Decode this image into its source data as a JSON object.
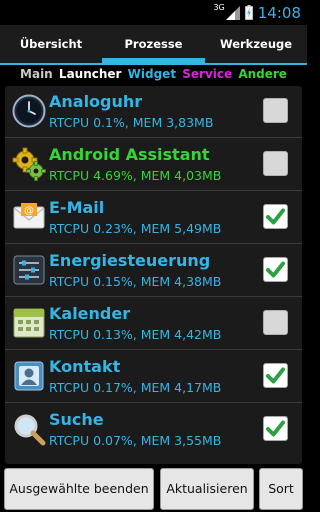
{
  "status_bar": {
    "network_type": "3G",
    "time": "14:08",
    "icons": [
      "signal-icon",
      "battery-charging-icon"
    ]
  },
  "tabs": [
    {
      "label": "Übersicht",
      "selected": false
    },
    {
      "label": "Prozesse",
      "selected": true
    },
    {
      "label": "Werkzeuge",
      "selected": false
    }
  ],
  "filters": [
    {
      "label": "Main",
      "color": "#c8c8c8"
    },
    {
      "label": "Launcher",
      "color": "#ffffff"
    },
    {
      "label": "Widget",
      "color": "#33b5e5"
    },
    {
      "label": "Service",
      "color": "#e020e0"
    },
    {
      "label": "Andere",
      "color": "#36d436"
    }
  ],
  "processes": [
    {
      "name": "Analoguhr",
      "stats": "RTCPU 0.1%, MEM 3,83MB",
      "color": "#33b5e5",
      "icon": "clock-icon",
      "checked": false
    },
    {
      "name": "Android Assistant",
      "stats": "RTCPU 4.69%, MEM 4,03MB",
      "color": "#36d436",
      "icon": "gears-icon",
      "checked": false
    },
    {
      "name": "E-Mail",
      "stats": "RTCPU 0.23%, MEM 5,49MB",
      "color": "#33b5e5",
      "icon": "email-icon",
      "checked": true
    },
    {
      "name": "Energiesteuerung",
      "stats": "RTCPU 0.15%, MEM 4,38MB",
      "color": "#33b5e5",
      "icon": "power-control-icon",
      "checked": true
    },
    {
      "name": "Kalender",
      "stats": "RTCPU 0.13%, MEM 4,42MB",
      "color": "#33b5e5",
      "icon": "calendar-icon",
      "checked": false
    },
    {
      "name": "Kontakt",
      "stats": "RTCPU 0.17%, MEM 4,17MB",
      "color": "#33b5e5",
      "icon": "contact-icon",
      "checked": true
    },
    {
      "name": "Suche",
      "stats": "RTCPU 0.07%, MEM 3,55MB",
      "color": "#33b5e5",
      "icon": "search-icon",
      "checked": true
    }
  ],
  "buttons": {
    "kill_selected": "Ausgewählte beenden",
    "refresh": "Aktualisieren",
    "sort": "Sort"
  },
  "colors": {
    "accent": "#33b5e5",
    "check": "#2ea043"
  }
}
